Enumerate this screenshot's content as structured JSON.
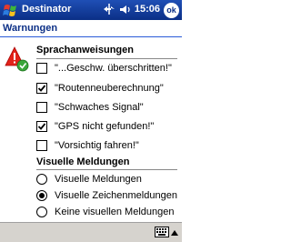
{
  "window": {
    "app_title": "Destinator",
    "clock": "15:06",
    "ok_label": "ok"
  },
  "header": {
    "title": "Warnungen"
  },
  "voice": {
    "title": "Sprachanweisungen",
    "items": [
      {
        "label": "\"...Geschw. überschritten!\"",
        "checked": false
      },
      {
        "label": "\"Routenneuberechnung\"",
        "checked": true
      },
      {
        "label": "\"Schwaches Signal\"",
        "checked": false
      },
      {
        "label": "\"GPS nicht gefunden!\"",
        "checked": true
      },
      {
        "label": "\"Vorsichtig fahren!\"",
        "checked": false
      }
    ]
  },
  "visual": {
    "title": "Visuelle Meldungen",
    "options": [
      {
        "label": "Visuelle Meldungen",
        "selected": false
      },
      {
        "label": "Visuelle Zeichenmeldungen",
        "selected": true
      },
      {
        "label": "Keine visuellen Meldungen",
        "selected": false
      }
    ]
  },
  "icons": {
    "start": "windows-flag-icon",
    "connectivity": "connectivity-arrows-icon",
    "volume": "speaker-icon",
    "warning": "warning-triangle-icon",
    "keyboard": "keyboard-icon"
  },
  "colors": {
    "titlebar": "#0b2f86",
    "header_text": "#0b2f86",
    "bottombar": "#d6d3ce"
  }
}
